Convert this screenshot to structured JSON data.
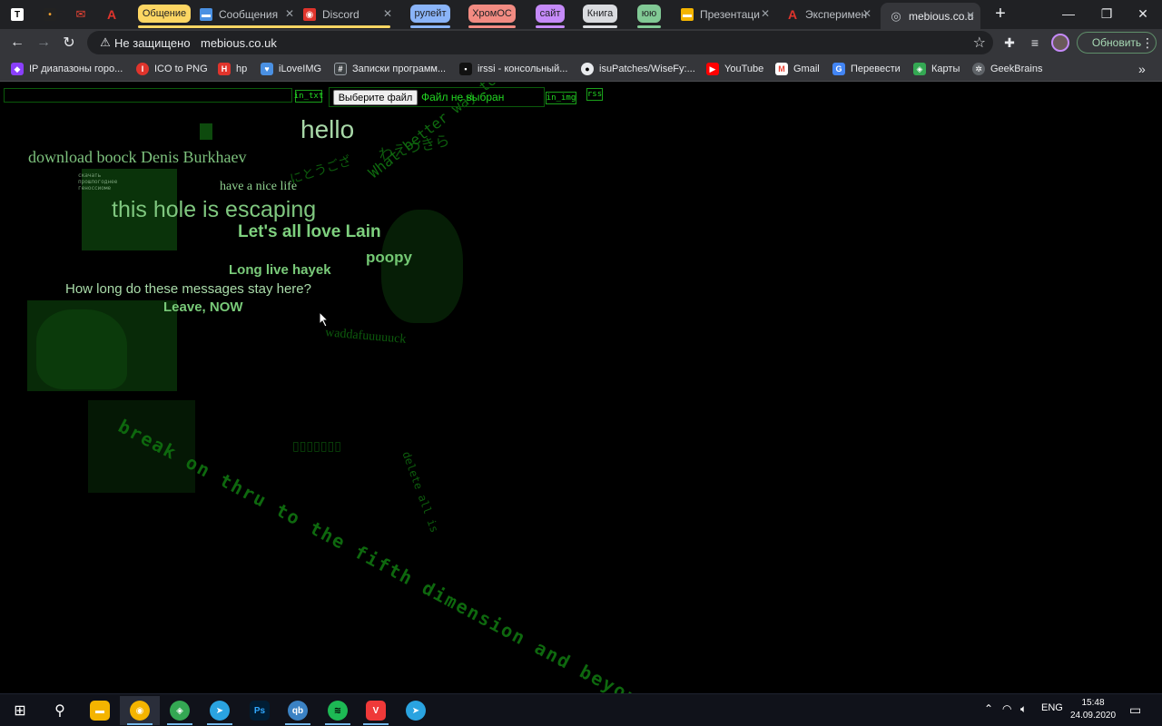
{
  "browser": {
    "tabs": [
      {
        "title": "",
        "icon": "T",
        "color": "#ffffff"
      },
      {
        "title": "",
        "icon": "•",
        "color": "#f0a030"
      },
      {
        "title": "",
        "icon": "M",
        "color": "#ea4335"
      },
      {
        "title": "",
        "icon": "A",
        "color": "#e0342c"
      },
      {
        "title": "Сообщения",
        "icon": "✉",
        "color": "#4a90e2"
      },
      {
        "title": "Discord",
        "icon": "◉",
        "color": "#e0342c"
      },
      {
        "title": "Презентаци",
        "icon": "▬",
        "color": "#f4b400"
      },
      {
        "title": "Эксперимен",
        "icon": "A",
        "color": "#e0342c"
      },
      {
        "title": "mebious.co.u",
        "icon": "◎",
        "color": "#bdc1c6"
      }
    ],
    "groups": [
      {
        "label": "Общение",
        "color": "#fdd663"
      },
      {
        "label": "рулейт",
        "color": "#8ab4f8"
      },
      {
        "label": "ХромОС",
        "color": "#f28b82"
      },
      {
        "label": "сайт",
        "color": "#c58af9"
      },
      {
        "label": "Книга",
        "color": "#dadce0"
      },
      {
        "label": "юю",
        "color": "#81c995"
      }
    ],
    "security_label": "Не защищено",
    "url": "mebious.co.uk",
    "update_label": "Обновить",
    "bookmarks": [
      {
        "label": "IP диапазоны горо...",
        "color": "#8a3ffc"
      },
      {
        "label": "ICO to PNG",
        "color": "#e0342c"
      },
      {
        "label": "hp",
        "color": "#e0342c"
      },
      {
        "label": "iLoveIMG",
        "color": "#4a90e2"
      },
      {
        "label": "Записки программ...",
        "color": "#9aa0a6"
      },
      {
        "label": "irssi - консольный...",
        "color": "#555555"
      },
      {
        "label": "isuPatches/WiseFy:...",
        "color": "#e8eaed"
      },
      {
        "label": "YouTube",
        "color": "#ff0000"
      },
      {
        "label": "Gmail",
        "color": "#ea4335"
      },
      {
        "label": "Перевести",
        "color": "#4285f4"
      },
      {
        "label": "Карты",
        "color": "#34a853"
      },
      {
        "label": "GeekBrains",
        "color": "#9aa0a6"
      }
    ]
  },
  "page": {
    "btn_txt": "in_txt",
    "file_button": "Выберите файл",
    "file_status": "Файл не выбран",
    "btn_img": "in_img",
    "btn_rss": "rss",
    "bg_texts": {
      "japanese_1": "わえつきら",
      "diag_phrase": "What better way to sh",
      "jp_2": "にとうござ",
      "waddafu": "waddafuuuuuck",
      "break_on": "break on thru to the fifth dimension and beyond",
      "delete_all": "delete all is",
      "boxes": "▯▯▯▯▯▯▯",
      "small_cyr": "скачать прошлогоднее геноссиоме"
    },
    "messages": [
      {
        "text": "hello",
        "color": "#a8d8a8"
      },
      {
        "text": "download boock Denis Burkhaev",
        "color": "#7dc27d"
      },
      {
        "text": "have a nice life",
        "color": "#8fd08f"
      },
      {
        "text": "this hole is escaping",
        "color": "#7fc77f"
      },
      {
        "text": "Let's all love Lain",
        "color": "#7ed07e"
      },
      {
        "text": "poopy",
        "color": "#73c873"
      },
      {
        "text": "Long live hayek",
        "color": "#7acb7a"
      },
      {
        "text": "How long do these messages stay here?",
        "color": "#a9dba9"
      },
      {
        "text": "Leave, NOW",
        "color": "#78c978"
      }
    ]
  },
  "taskbar": {
    "lang": "ENG",
    "time": "15:48",
    "date": "24.09.2020"
  }
}
